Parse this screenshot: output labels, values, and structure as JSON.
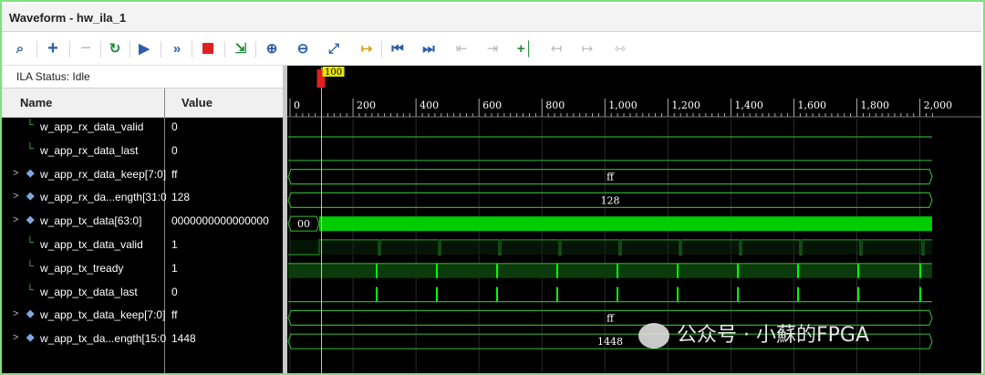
{
  "window": {
    "title": "Waveform - hw_ila_1"
  },
  "toolbar": {
    "icons": [
      "search-icon",
      "zoom-in-plus-icon",
      "minus-icon",
      "refresh-icon",
      "run-icon",
      "run-fast-icon",
      "stop-icon",
      "export-icon",
      "zoom-in-icon",
      "zoom-out-icon",
      "zoom-fit-icon",
      "go-to-cursor-icon",
      "go-to-start-icon",
      "go-to-end-icon",
      "prev-transition-icon",
      "next-transition-icon",
      "add-marker-icon",
      "prev-marker-icon",
      "next-marker-icon",
      "swap-cursor-icon"
    ]
  },
  "status": {
    "text": "ILA Status:  Idle"
  },
  "columns": {
    "name": "Name",
    "value": "Value"
  },
  "signals": [
    {
      "name": "w_app_rx_data_valid",
      "value": "0",
      "bus": false
    },
    {
      "name": "w_app_rx_data_last",
      "value": "0",
      "bus": false
    },
    {
      "name": "w_app_rx_data_keep[7:0]",
      "value": "ff",
      "bus": true
    },
    {
      "name": "w_app_rx_da...ength[31:0]",
      "value": "128",
      "bus": true
    },
    {
      "name": "w_app_tx_data[63:0]",
      "value": "0000000000000000",
      "bus": true
    },
    {
      "name": "w_app_tx_data_valid",
      "value": "1",
      "bus": false
    },
    {
      "name": "w_app_tx_tready",
      "value": "1",
      "bus": false
    },
    {
      "name": "w_app_tx_data_last",
      "value": "0",
      "bus": false
    },
    {
      "name": "w_app_tx_data_keep[7:0]",
      "value": "ff",
      "bus": true
    },
    {
      "name": "w_app_tx_da...ength[15:0]",
      "value": "1448",
      "bus": true
    }
  ],
  "timeline": {
    "ticks": [
      "0",
      "200",
      "400",
      "600",
      "800",
      "1,000",
      "1,200",
      "1,400",
      "1,600",
      "1,800",
      "2,000"
    ],
    "cursor_label": "100",
    "cursor_value": 100,
    "range": [
      0,
      2048
    ]
  },
  "bus_labels": {
    "rx_keep": "ff",
    "rx_length": "128",
    "tx_data_start": "00",
    "tx_keep": "ff",
    "tx_length": "1448"
  },
  "watermark": {
    "text": "公众号 · 小蘇的FPGA"
  },
  "colors": {
    "wave": "#00ff00",
    "bus_outline": "#2ea82e",
    "cursor": "#e0e000",
    "marker": "#e02020"
  }
}
